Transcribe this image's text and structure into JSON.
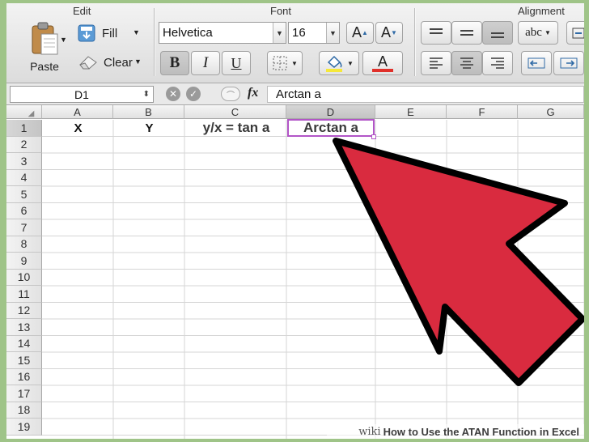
{
  "ribbon": {
    "edit": {
      "title": "Edit",
      "paste_label": "Paste",
      "fill_label": "Fill",
      "clear_label": "Clear"
    },
    "font": {
      "title": "Font",
      "font_name": "Helvetica",
      "font_size": "16",
      "bold": "B",
      "italic": "I",
      "underline": "U",
      "grow": "A",
      "shrink": "A",
      "highlight_color": "#f5e83a",
      "font_color": "#e0302a"
    },
    "alignment": {
      "title": "Alignment",
      "wrap_label": "abc"
    }
  },
  "formula_bar": {
    "name_box": "D1",
    "fx_label": "fx",
    "formula": "Arctan a"
  },
  "sheet": {
    "columns": [
      "A",
      "B",
      "C",
      "D",
      "E",
      "F",
      "G"
    ],
    "rows": [
      "1",
      "2",
      "3",
      "4",
      "5",
      "6",
      "7",
      "8",
      "9",
      "10",
      "11",
      "12",
      "13",
      "14",
      "15",
      "16",
      "17",
      "18",
      "19"
    ],
    "selected_cell": "D1",
    "cells": {
      "A1": "X",
      "B1": "Y",
      "C1": "y/x = tan a",
      "D1": "Arctan a"
    }
  },
  "overlay": {
    "arrow_color": "#d92b3f"
  },
  "footer": {
    "brand": "wiki",
    "title": "How to Use the ATAN Function in Excel"
  }
}
